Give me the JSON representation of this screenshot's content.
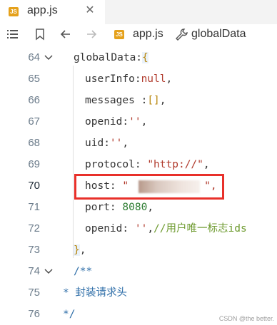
{
  "tab": {
    "badge": "JS",
    "title": "app.js",
    "close": "✕"
  },
  "breadcrumb": {
    "badge": "JS",
    "file": "app.js",
    "separator": ">",
    "symbol": "globalData"
  },
  "lines": [
    {
      "num": "64",
      "a": "globalData:",
      "b": "{"
    },
    {
      "num": "65",
      "a": "userInfo:",
      "b": "null",
      "c": ","
    },
    {
      "num": "66",
      "a": "messages :",
      "b": "[]",
      "c": ","
    },
    {
      "num": "67",
      "a": "openid:",
      "b": "''",
      "c": ","
    },
    {
      "num": "68",
      "a": "uid:",
      "b": "''",
      "c": ","
    },
    {
      "num": "69",
      "a": "protocol: ",
      "b": "\"http://\"",
      "c": ","
    },
    {
      "num": "70",
      "a": "host: ",
      "b": "\"",
      "c": "\",",
      "blurred": ""
    },
    {
      "num": "71",
      "a": "port: ",
      "b": "8080",
      "c": ","
    },
    {
      "num": "72",
      "a": "openid: ",
      "b": "''",
      "c": ",",
      "d": "//用户唯一标志ids"
    },
    {
      "num": "73",
      "a": "}",
      "b": ","
    },
    {
      "num": "74",
      "a": "/**"
    },
    {
      "num": "75",
      "a": "* 封装请求头"
    },
    {
      "num": "76",
      "a": "*/"
    }
  ],
  "watermark": "CSDN @the better.",
  "colors": {
    "highlight": "#e8302a",
    "jsBadge": "#e5a11b"
  }
}
